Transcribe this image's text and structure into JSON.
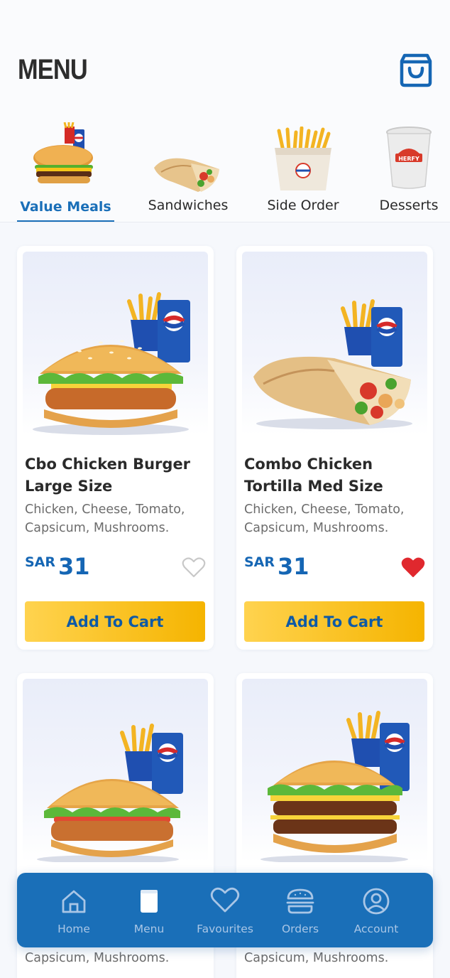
{
  "header": {
    "title": "MENU",
    "cart_icon": "shopping-bag-icon"
  },
  "categories": [
    {
      "label": "Value Meals",
      "icon": "burger-meal-icon",
      "active": true
    },
    {
      "label": "Sandwiches",
      "icon": "wrap-icon",
      "active": false
    },
    {
      "label": "Side Order",
      "icon": "fries-icon",
      "active": false
    },
    {
      "label": "Desserts",
      "icon": "dessert-cup-icon",
      "active": false
    }
  ],
  "products": [
    {
      "name": "Cbo Chicken Burger Large Size",
      "description": "Chicken, Cheese, Tomato, Capsicum, Mushrooms.",
      "currency": "SAR",
      "price": "31",
      "favourite": false,
      "cta": "Add To Cart"
    },
    {
      "name": "Combo Chicken Tortilla Med Size",
      "description": "Chicken, Cheese, Tomato, Capsicum, Mushrooms.",
      "currency": "SAR",
      "price": "31",
      "favourite": true,
      "cta": "Add To Cart"
    },
    {
      "name": "",
      "description": "Capsicum, Mushrooms."
    },
    {
      "name": "",
      "description": "Capsicum, Mushrooms."
    }
  ],
  "nav": [
    {
      "label": "Home",
      "icon": "home-icon",
      "active": false
    },
    {
      "label": "Menu",
      "icon": "menu-icon",
      "active": true
    },
    {
      "label": "Favourites",
      "icon": "heart-icon",
      "active": false
    },
    {
      "label": "Orders",
      "icon": "burger-icon",
      "active": false
    },
    {
      "label": "Account",
      "icon": "user-icon",
      "active": false
    }
  ],
  "colors": {
    "primary": "#1a6fb8",
    "accent": "#f5b400",
    "favourite": "#e0282e"
  }
}
